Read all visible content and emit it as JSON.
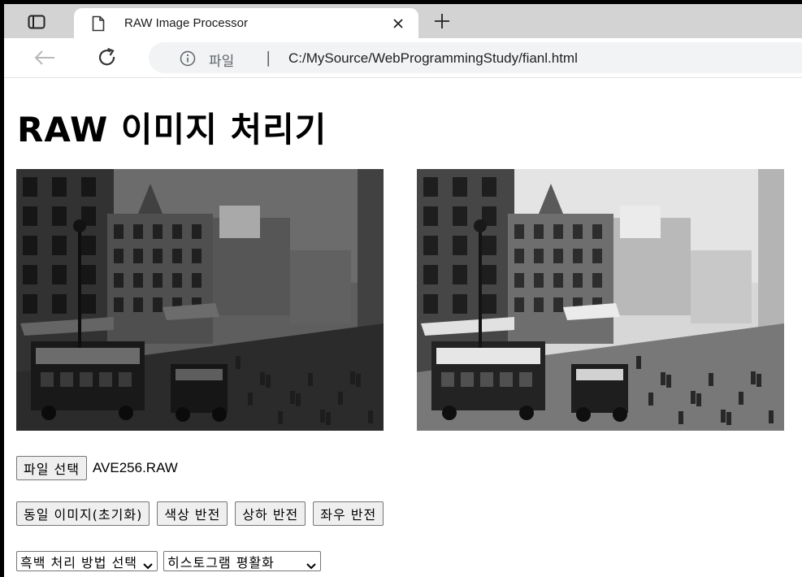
{
  "browser": {
    "tab_title": "RAW Image Processor",
    "address_scheme_label": "파일",
    "address_separator": "|",
    "url": "C:/MySource/WebProgrammingStudy/fianl.html",
    "icons": [
      "tab-actions-icon",
      "page-icon",
      "close-icon",
      "plus-icon",
      "back-arrow-icon",
      "refresh-icon",
      "info-icon",
      "chevron-down-icon"
    ]
  },
  "page": {
    "title": "RAW 이미지 처리기"
  },
  "file": {
    "choose_label": "파일 선택",
    "selected_name": "AVE256.RAW"
  },
  "actions": {
    "identity_label": "동일 이미지(초기화)",
    "invert_label": "색상 반전",
    "flip_vertical_label": "상하 반전",
    "flip_horizontal_label": "좌우 반전"
  },
  "selects": {
    "bw_method": "흑백 처리 방법 선택",
    "histogram": "히스토그램 평활화"
  },
  "colors": {
    "tab_strip": "#d3d3d3",
    "omnibox": "#f1f3f4",
    "button_bg": "#efefef",
    "button_border": "#767676"
  }
}
